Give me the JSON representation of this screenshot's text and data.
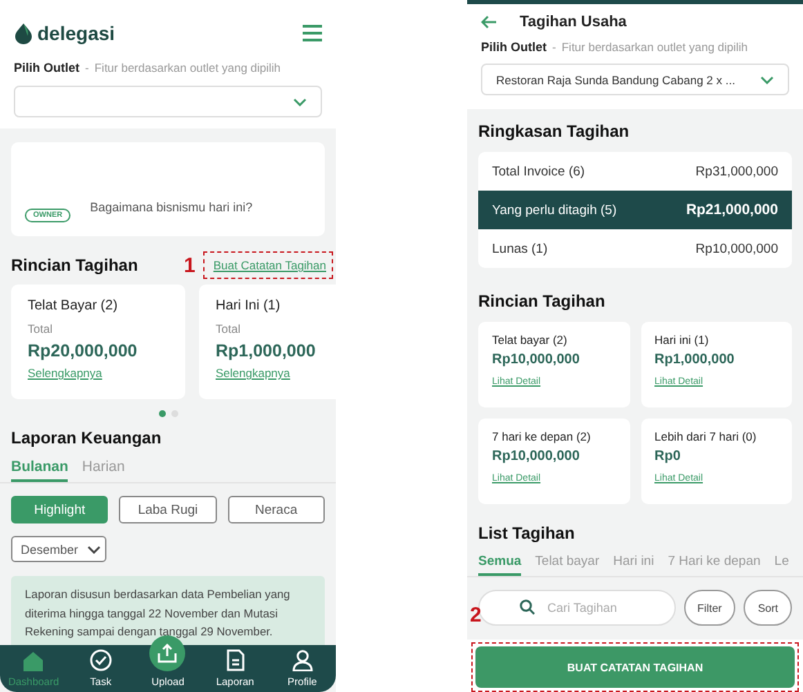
{
  "dashboard": {
    "logo": "delegasi",
    "outlet": {
      "label": "Pilih Outlet",
      "separator": "-",
      "hint": "Fitur berdasarkan outlet yang dipilih"
    },
    "greeting": {
      "text": "Bagaimana bisnismu hari ini?",
      "badge": "OWNER"
    },
    "billing": {
      "title": "Rincian Tagihan",
      "annotation": "1",
      "create_link": "Buat Catatan Tagihan",
      "cards": [
        {
          "title": "Telat Bayar (2)",
          "label": "Total",
          "amount": "Rp20,000,000",
          "link": "Selengkapnya"
        },
        {
          "title": "Hari Ini (1)",
          "label": "Total",
          "amount": "Rp1,000,000",
          "link": "Selengkapnya"
        }
      ],
      "pager": [
        {
          "selected": true
        },
        {
          "selected": false
        }
      ]
    },
    "report": {
      "title": "Laporan Keuangan",
      "tabs": [
        {
          "label": "Bulanan",
          "selected": true
        },
        {
          "label": "Harian",
          "selected": false
        }
      ],
      "views": [
        {
          "label": "Highlight",
          "selected": true
        },
        {
          "label": "Laba Rugi",
          "selected": false
        },
        {
          "label": "Neraca",
          "selected": false
        }
      ],
      "month": "Desember",
      "note": "Laporan disusun berdasarkan data Pembelian yang diterima hingga tanggal 22 November dan Mutasi Rekening sampai dengan tanggal 29 November."
    },
    "nav": [
      {
        "label": "Dashboard",
        "kind": "plain",
        "selected": true
      },
      {
        "label": "Task",
        "kind": "plain",
        "selected": false
      },
      {
        "label": "Upload",
        "kind": "raised",
        "selected": false
      },
      {
        "label": "Laporan",
        "kind": "plain",
        "selected": false
      },
      {
        "label": "Profile",
        "kind": "plain",
        "selected": false
      }
    ]
  },
  "tagihan_usaha": {
    "title": "Tagihan Usaha",
    "outlet": {
      "label": "Pilih Outlet",
      "separator": "-",
      "hint": "Fitur berdasarkan outlet yang dipilih",
      "value": "Restoran Raja Sunda Bandung Cabang 2 x ..."
    },
    "summary": {
      "title": "Ringkasan Tagihan",
      "rows": [
        {
          "label": "Total Invoice (6)",
          "amount": "Rp31,000,000",
          "selected": false
        },
        {
          "label": "Yang perlu ditagih (5)",
          "amount": "Rp21,000,000",
          "selected": true
        },
        {
          "label": "Lunas (1)",
          "amount": "Rp10,000,000",
          "selected": false
        }
      ]
    },
    "details": {
      "title": "Rincian Tagihan",
      "cards": [
        {
          "title": "Telat bayar (2)",
          "amount": "Rp10,000,000",
          "link": "Lihat Detail"
        },
        {
          "title": "Hari ini (1)",
          "amount": "Rp1,000,000",
          "link": "Lihat Detail"
        },
        {
          "title": "7 hari ke depan (2)",
          "amount": "Rp10,000,000",
          "link": "Lihat Detail"
        },
        {
          "title": "Lebih dari 7 hari (0)",
          "amount": "Rp0",
          "link": "Lihat Detail"
        }
      ]
    },
    "list": {
      "title": "List Tagihan",
      "tabs": [
        {
          "label": "Semua",
          "selected": true
        },
        {
          "label": "Telat bayar",
          "selected": false
        },
        {
          "label": "Hari ini",
          "selected": false
        },
        {
          "label": "7 Hari ke depan",
          "selected": false
        },
        {
          "label": "Le",
          "selected": false
        }
      ],
      "search": {
        "placeholder": "Cari Tagihan"
      },
      "buttons": [
        "Filter",
        "Sort"
      ]
    },
    "annotation": "2",
    "create_button": "BUAT CATATAN TAGIHAN"
  }
}
